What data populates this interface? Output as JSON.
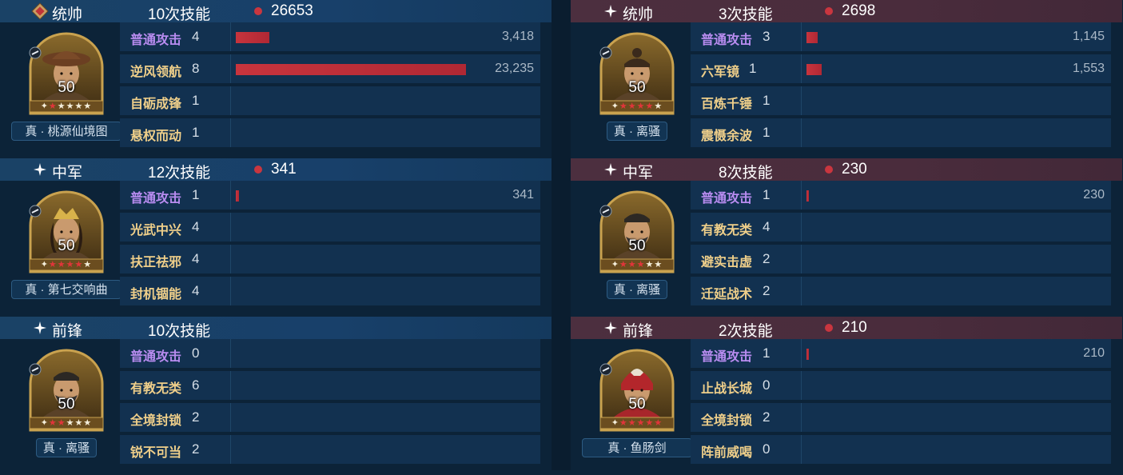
{
  "colors": {
    "left_header": "#18406a",
    "right_header": "#4a2c3c",
    "bar": "#c8343d",
    "basic_skill": "#b88cf0",
    "tactic_skill": "#efcf8a"
  },
  "teams": {
    "left": {
      "sections": [
        {
          "role": "统帅",
          "role_icon": "commander-seal-icon",
          "count": "10次技能",
          "damage": "26653",
          "general": {
            "level": "50",
            "stars_red": 1,
            "stars_total": 6,
            "tag": "真·桃源仙境图",
            "tag_display": "真 · 桃源仙境图",
            "portrait": "hat-general-portrait"
          },
          "skills": [
            {
              "name": "普通攻击",
              "type": "basic",
              "count": "4",
              "value": "3,418",
              "bar_fraction": 0.147
            },
            {
              "name": "逆风领航",
              "type": "tactic",
              "count": "8",
              "value": "23,235",
              "bar_fraction": 1.0
            },
            {
              "name": "自砺成锋",
              "type": "tactic",
              "count": "1",
              "value": ""
            },
            {
              "name": "悬权而动",
              "type": "tactic",
              "count": "1",
              "value": ""
            }
          ]
        },
        {
          "role": "中军",
          "role_icon": "sparkle-icon",
          "count": "12次技能",
          "damage": "341",
          "general": {
            "level": "50",
            "stars_red": 4,
            "stars_total": 6,
            "tag_display": "真 · 第七交响曲",
            "portrait": "crowned-general-portrait"
          },
          "skills": [
            {
              "name": "普通攻击",
              "type": "basic",
              "count": "1",
              "value": "341",
              "bar_fraction": 0.015
            },
            {
              "name": "光武中兴",
              "type": "tactic",
              "count": "4",
              "value": ""
            },
            {
              "name": "扶正祛邪",
              "type": "tactic",
              "count": "4",
              "value": ""
            },
            {
              "name": "封机锢能",
              "type": "tactic",
              "count": "4",
              "value": ""
            }
          ]
        },
        {
          "role": "前锋",
          "role_icon": "sparkle-icon",
          "count": "10次技能",
          "damage": "",
          "general": {
            "level": "50",
            "stars_red": 2,
            "stars_total": 6,
            "tag_display": "真 · 离骚",
            "portrait": "bearded-general-portrait"
          },
          "skills": [
            {
              "name": "普通攻击",
              "type": "basic",
              "count": "0",
              "value": ""
            },
            {
              "name": "有教无类",
              "type": "tactic",
              "count": "6",
              "value": ""
            },
            {
              "name": "全境封锁",
              "type": "tactic",
              "count": "2",
              "value": ""
            },
            {
              "name": "锐不可当",
              "type": "tactic",
              "count": "2",
              "value": ""
            }
          ]
        }
      ]
    },
    "right": {
      "sections": [
        {
          "role": "统帅",
          "role_icon": "sparkle-icon",
          "count": "3次技能",
          "damage": "2698",
          "general": {
            "level": "50",
            "stars_red": 4,
            "stars_total": 6,
            "tag_display": "真 · 离骚",
            "portrait": "topknot-general-portrait"
          },
          "skills": [
            {
              "name": "普通攻击",
              "type": "basic",
              "count": "3",
              "value": "1,145",
              "bar_fraction": 0.049
            },
            {
              "name": "六军镜",
              "type": "tactic",
              "count": "1",
              "value": "1,553",
              "bar_fraction": 0.067
            },
            {
              "name": "百炼千锤",
              "type": "tactic",
              "count": "1",
              "value": ""
            },
            {
              "name": "震慑余波",
              "type": "tactic",
              "count": "1",
              "value": ""
            }
          ]
        },
        {
          "role": "中军",
          "role_icon": "sparkle-icon",
          "count": "8次技能",
          "damage": "230",
          "general": {
            "level": "50",
            "stars_red": 3,
            "stars_total": 6,
            "tag_display": "真 · 离骚",
            "portrait": "bearded-general-portrait"
          },
          "skills": [
            {
              "name": "普通攻击",
              "type": "basic",
              "count": "1",
              "value": "230",
              "bar_fraction": 0.01
            },
            {
              "name": "有教无类",
              "type": "tactic",
              "count": "4",
              "value": ""
            },
            {
              "name": "避实击虚",
              "type": "tactic",
              "count": "2",
              "value": ""
            },
            {
              "name": "迁延战术",
              "type": "tactic",
              "count": "2",
              "value": ""
            }
          ]
        },
        {
          "role": "前锋",
          "role_icon": "sparkle-icon",
          "count": "2次技能",
          "damage": "210",
          "general": {
            "level": "50",
            "stars_red": 5,
            "stars_total": 6,
            "tag_display": "真 · 鱼肠剑",
            "portrait": "red-helmet-general-portrait"
          },
          "skills": [
            {
              "name": "普通攻击",
              "type": "basic",
              "count": "1",
              "value": "210",
              "bar_fraction": 0.009
            },
            {
              "name": "止战长城",
              "type": "tactic",
              "count": "0",
              "value": ""
            },
            {
              "name": "全境封锁",
              "type": "tactic",
              "count": "2",
              "value": ""
            },
            {
              "name": "阵前威喝",
              "type": "tactic",
              "count": "0",
              "value": ""
            }
          ]
        }
      ]
    }
  }
}
